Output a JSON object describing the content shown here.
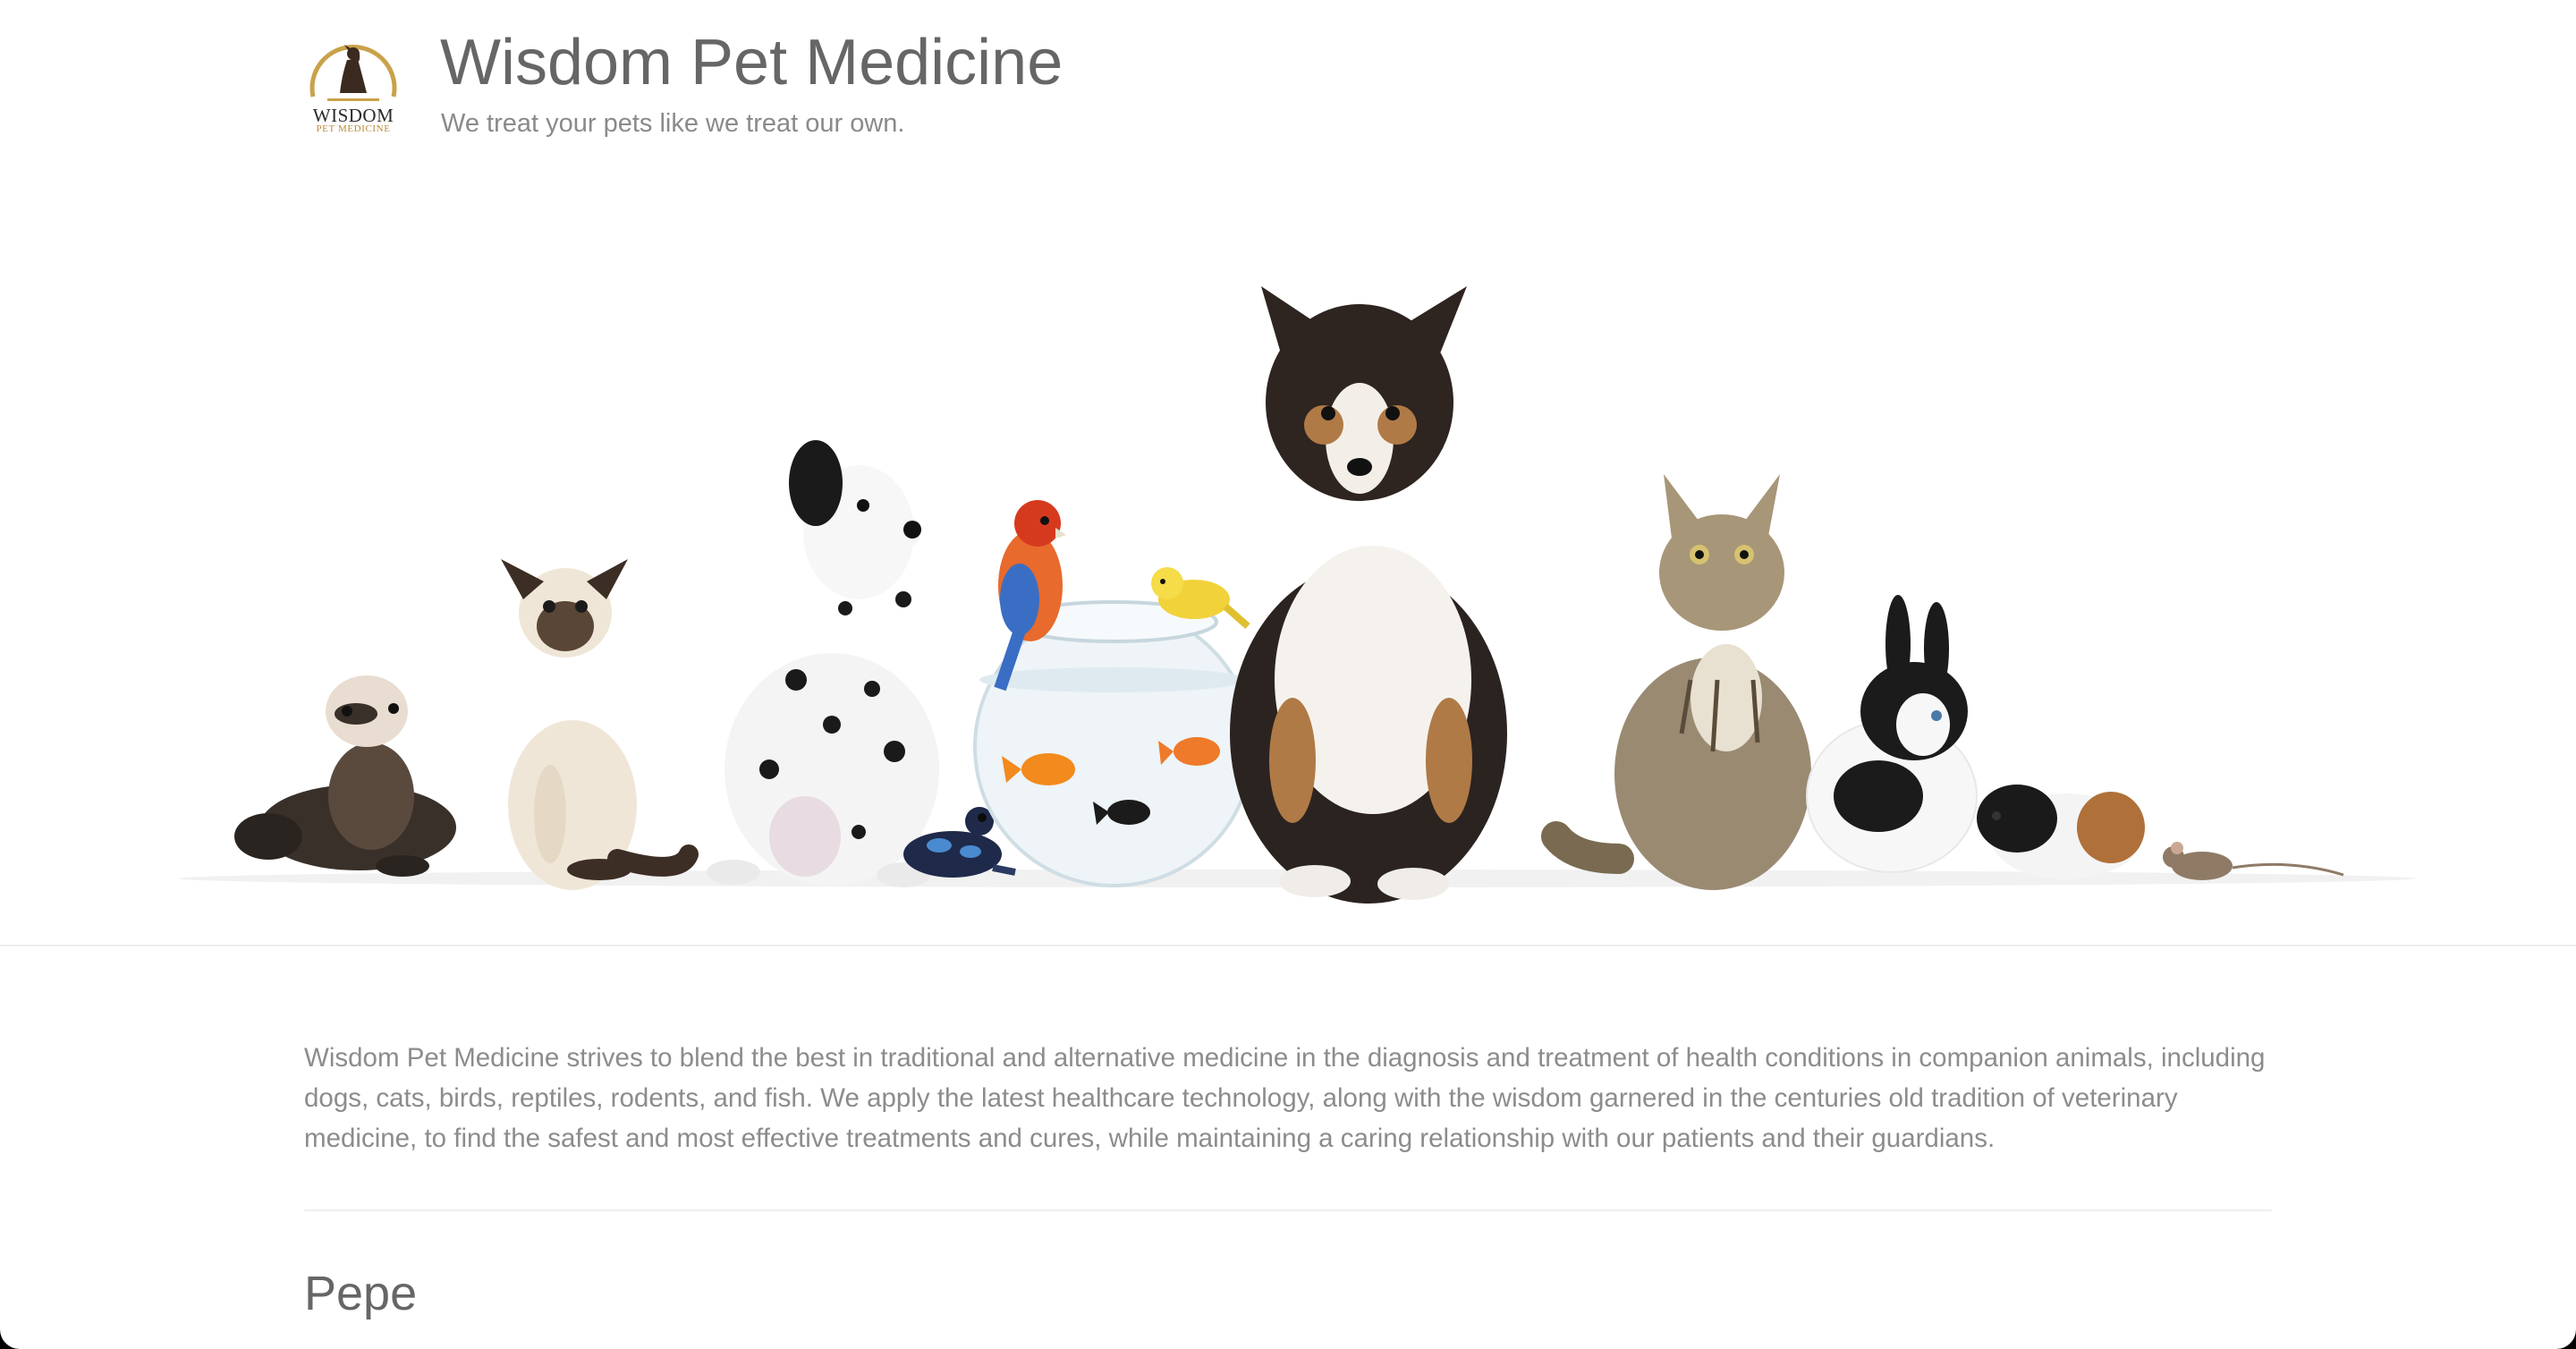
{
  "header": {
    "logo_word": "WISDOM",
    "logo_sub": "PET MEDICINE",
    "title": "Wisdom Pet Medicine",
    "tagline": "We treat your pets like we treat our own."
  },
  "hero": {
    "animals": [
      "ferret",
      "siamese-cat",
      "dalmatian",
      "parrot",
      "canary",
      "goldfish-bowl",
      "poison-dart-frog",
      "collie",
      "maine-coon-cat",
      "rabbit",
      "guinea-pig",
      "mouse"
    ]
  },
  "intro": {
    "text": "Wisdom Pet Medicine strives to blend the best in traditional and alternative medicine in the diagnosis and treatment of health conditions in companion animals, including dogs, cats, birds, reptiles, rodents, and fish. We apply the latest healthcare technology, along with the wisdom garnered in the centuries old tradition of veterinary medicine, to find the safest and most effective treatments and cures, while maintaining a caring relationship with our patients and their guardians."
  },
  "section": {
    "title": "Pepe"
  },
  "colors": {
    "heading": "#666666",
    "body_text": "#8c8c8c",
    "logo_gold": "#c9a24a",
    "divider": "#eeeeee"
  }
}
